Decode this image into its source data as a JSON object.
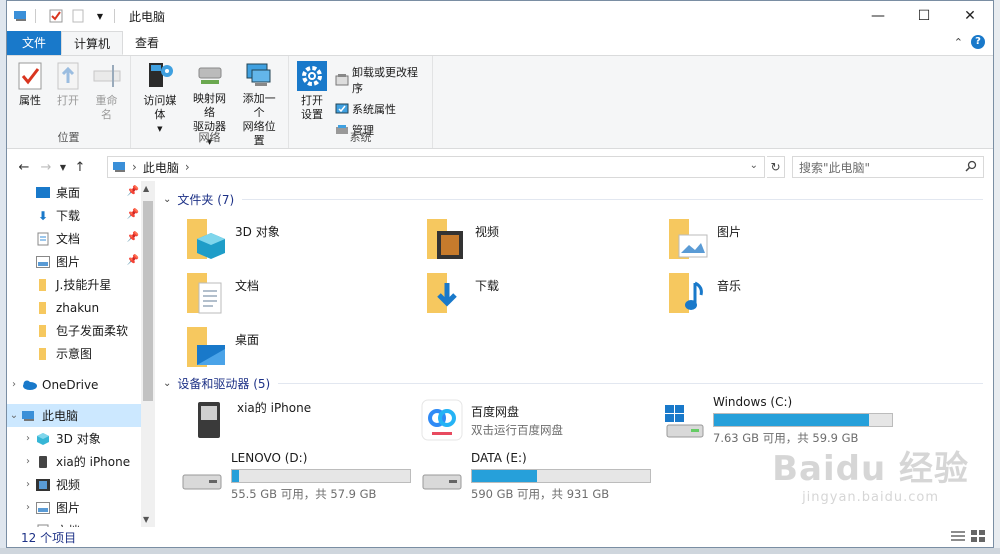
{
  "window": {
    "title": "此电脑"
  },
  "titlebar": {
    "minimize": "—",
    "maximize": "☐",
    "close": "✕"
  },
  "tabs": [
    {
      "label": "文件"
    },
    {
      "label": "计算机"
    },
    {
      "label": "查看"
    }
  ],
  "help_label": "?",
  "ribbon": {
    "location": {
      "group_label": "位置",
      "properties": "属性",
      "open": "打开",
      "rename": "重命名"
    },
    "network": {
      "group_label": "网络",
      "access_media": "访问媒体",
      "map_drive_line1": "映射网络",
      "map_drive_line2": "驱动器",
      "add_location_line1": "添加一个",
      "add_location_line2": "网络位置"
    },
    "system": {
      "group_label": "系统",
      "open_settings_line1": "打开",
      "open_settings_line2": "设置",
      "uninstall": "卸载或更改程序",
      "system_properties": "系统属性",
      "manage": "管理"
    }
  },
  "address": {
    "path": "此电脑",
    "separator": "›",
    "search_placeholder": "搜索\"此电脑\""
  },
  "nav_pane": {
    "items": [
      {
        "label": "桌面",
        "pinned": true
      },
      {
        "label": "下载",
        "pinned": true
      },
      {
        "label": "文档",
        "pinned": true
      },
      {
        "label": "图片",
        "pinned": true
      },
      {
        "label": "J.技能升星",
        "pinned": false
      },
      {
        "label": "zhakun",
        "pinned": false
      },
      {
        "label": "包子发面柔软",
        "pinned": false
      },
      {
        "label": "示意图",
        "pinned": false
      },
      {
        "label": "OneDrive",
        "pinned": false
      },
      {
        "label": "此电脑",
        "pinned": false
      },
      {
        "label": "3D 对象",
        "pinned": false
      },
      {
        "label": "xia的 iPhone",
        "pinned": false
      },
      {
        "label": "视频",
        "pinned": false
      },
      {
        "label": "图片",
        "pinned": false
      },
      {
        "label": "文档",
        "pinned": false
      }
    ]
  },
  "folders_section": {
    "title": "文件夹 (7)"
  },
  "folders": [
    {
      "name": "3D 对象"
    },
    {
      "name": "视频"
    },
    {
      "name": "图片"
    },
    {
      "name": "文档"
    },
    {
      "name": "下载"
    },
    {
      "name": "音乐"
    },
    {
      "name": "桌面"
    }
  ],
  "devices_section": {
    "title": "设备和驱动器 (5)"
  },
  "devices": [
    {
      "name": "xia的 iPhone"
    },
    {
      "name": "百度网盘",
      "sub": "双击运行百度网盘"
    },
    {
      "name": "Windows (C:)",
      "space": "7.63 GB 可用，共 59.9 GB",
      "used_fraction": 0.873
    },
    {
      "name": "LENOVO (D:)",
      "space": "55.5 GB 可用，共 57.9 GB",
      "used_fraction": 0.041
    },
    {
      "name": "DATA (E:)",
      "space": "590 GB 可用，共 931 GB",
      "used_fraction": 0.366
    }
  ],
  "status": {
    "count": "12 个项目"
  },
  "watermark": {
    "brand": "Baidu 经验",
    "url": "jingyan.baidu.com"
  },
  "colors": {
    "accent": "#1979ca",
    "folder": "#f6c85f",
    "bar_fill": "#26a0da",
    "selection": "#cce8ff"
  }
}
